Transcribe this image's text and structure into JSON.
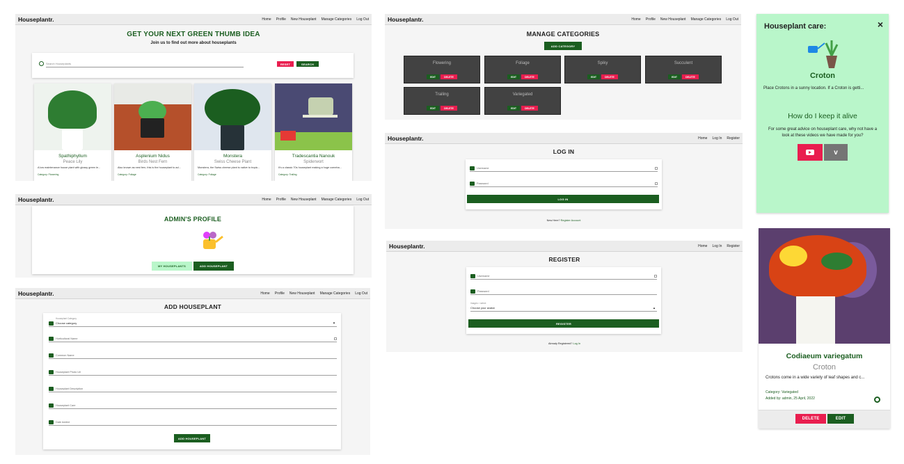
{
  "nav": {
    "brand": "Houseplantr.",
    "home": "Home",
    "profile": "Profile",
    "new": "New Houseplant",
    "manage": "Manage Categories",
    "logout": "Log Out",
    "login": "Log In",
    "register": "Register"
  },
  "home": {
    "title": "GET YOUR NEXT GREEN THUMB IDEA",
    "subtitle": "Join us to find out more about houseplants",
    "search_placeholder": "Search Houseplants",
    "reset": "RESET",
    "search": "SEARCH",
    "plants": [
      {
        "name": "Spathiphyllum",
        "common": "Peace Lily",
        "desc": "A low maintenance house plant with glossy green le...",
        "cat": "Category: Flowering"
      },
      {
        "name": "Asplenium Nidus",
        "common": "Birds Nest Fern",
        "desc": "Also known as nest fern, this is the houseplant to ad...",
        "cat": "Category: Foliage"
      },
      {
        "name": "Monstera",
        "common": "Swiss Cheese Plant",
        "desc": "Monstera, the Swiss cheese plant is native to tropic...",
        "cat": "Category: Foliage"
      },
      {
        "name": "Tradescantia Nanouk",
        "common": "Spiderwort",
        "desc": "It's a classic 70s houseplant making a huge comeba...",
        "cat": "Category: Trailing"
      }
    ]
  },
  "profile": {
    "title": "ADMIN'S PROFILE",
    "my": "MY HOUSEPLANTS",
    "add": "ADD HOUSEPLANT"
  },
  "addplant": {
    "title": "ADD HOUSEPLANT",
    "cat_label": "Houseplant Category",
    "cat_value": "Choose category",
    "f1": "Horticultural Name",
    "f2": "Common Name",
    "f3": "Houseplant Photo Url",
    "f4": "Houseplant Description",
    "f5": "Houseplant Care",
    "f6": "Date Added",
    "submit": "ADD HOUSEPLANT"
  },
  "manage": {
    "title": "MANAGE CATEGORIES",
    "add": "ADD CATEGORY",
    "edit": "EDIT",
    "delete": "DELETE",
    "cats": [
      "Flowering",
      "Foliage",
      "Spiky",
      "Succulent",
      "Trailing",
      "Variegated"
    ]
  },
  "login": {
    "title": "LOG IN",
    "user": "Username",
    "pass": "Password",
    "btn": "LOG IN",
    "foot_q": "New Here?",
    "foot_a": "Register Account"
  },
  "register": {
    "title": "REGISTER",
    "user": "Username",
    "pass": "Password",
    "avatar_label": "Images > select",
    "avatar_value": "Choose your avatar",
    "btn": "REGISTER",
    "foot_q": "Already Registered?",
    "foot_a": "Log In"
  },
  "modal": {
    "title": "Houseplant care:",
    "plant": "Croton",
    "care": "Place Crotons in a sunny location. If a Croton is getti...",
    "subtitle": "How do I keep it alive",
    "advice": "For some great advice on houseplant care, why not have a look at these videos we have made for you?",
    "close": "×"
  },
  "detail": {
    "name": "Codiaeum variegatum",
    "common": "Croton",
    "desc": "Crotons come in a wide variety of leaf shapes and c...",
    "cat": "Category: Variegated",
    "added": "Added by: admin, 25 April, 2022",
    "delete": "DELETE",
    "edit": "EDIT"
  },
  "colors": {
    "green": "#1b5e20",
    "red": "#e91e4f",
    "mint": "#b9f6ca"
  }
}
